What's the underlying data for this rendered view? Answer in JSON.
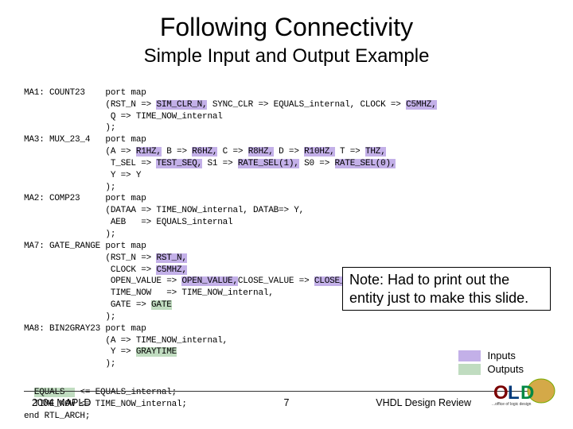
{
  "title": "Following Connectivity",
  "subtitle": "Simple Input and Output Example",
  "code": {
    "l1a": "MA1: COUNT23    port map",
    "l1b": "                (RST_N => ",
    "l1b_h1": "SIM_CLR_N,",
    "l1b_m": " SYNC_CLR => EQUALS_internal, CLOCK => ",
    "l1b_h2": "C5MHZ,",
    "l1c": "                 Q => TIME_NOW_internal",
    "l1d": "                );",
    "l2a": "MA3: MUX_23_4   port map",
    "l2b": "                (A => ",
    "l2h1": "R1HZ,",
    "l2m1": " B => ",
    "l2h2": "R6HZ,",
    "l2m2": " C => ",
    "l2h3": "R8HZ,",
    "l2m3": " D => ",
    "l2h4": "R10HZ,",
    "l2m4": " T => ",
    "l2h5": "THZ,",
    "l2c": "                 T_SEL => ",
    "l2ch1": "TEST_SEQ,",
    "l2cm1": " S1 => ",
    "l2ch2": "RATE_SEL(1),",
    "l2cm2": " S0 => ",
    "l2ch3": "RATE_SEL(0),",
    "l2d": "                 Y => Y",
    "l2e": "                );",
    "l3a": "MA2: COMP23     port map",
    "l3b": "                (DATAA => TIME_NOW_internal, DATAB=> Y,",
    "l3c": "                 AEB   => EQUALS_internal",
    "l3d": "                );",
    "l4a": "MA7: GATE_RANGE port map",
    "l4b": "                (RST_N => ",
    "l4b_h": "RST_N,",
    "l4c": "                 CLOCK => ",
    "l4c_h": "C5MHZ,",
    "l4d": "                 OPEN_VALUE => ",
    "l4d_h1": "OPEN_VALUE,",
    "l4d_m": "CLOSE_VALUE => ",
    "l4d_h2": "CLOSE_VALUE,",
    "l4e": "                 TIME_NOW   => TIME_NOW_internal,",
    "l4f": "                 GATE => ",
    "l4f_h": "GATE",
    "l4g": "                );",
    "l5a": "MA8: BIN2GRAY23 port map",
    "l5b": "                (A => TIME_NOW_internal,",
    "l5c": "                 Y => ",
    "l5c_h": "GRAYTIME",
    "l5d": "                );",
    "b1a": "  ",
    "b1a_h": "EQUALS  ",
    "b1a_t": " <= EQUALS_internal;",
    "b2": "  TIME_NOW <= TIME_NOW_internal;",
    "b3": "end RTL_ARCH;"
  },
  "note": "Note: Had to print out the entity just to make this slide.",
  "legend": {
    "inputs": "Inputs",
    "outputs": "Outputs"
  },
  "footer": {
    "left": "2004 MAPLD",
    "center": "7",
    "right": "VHDL Design Review"
  }
}
